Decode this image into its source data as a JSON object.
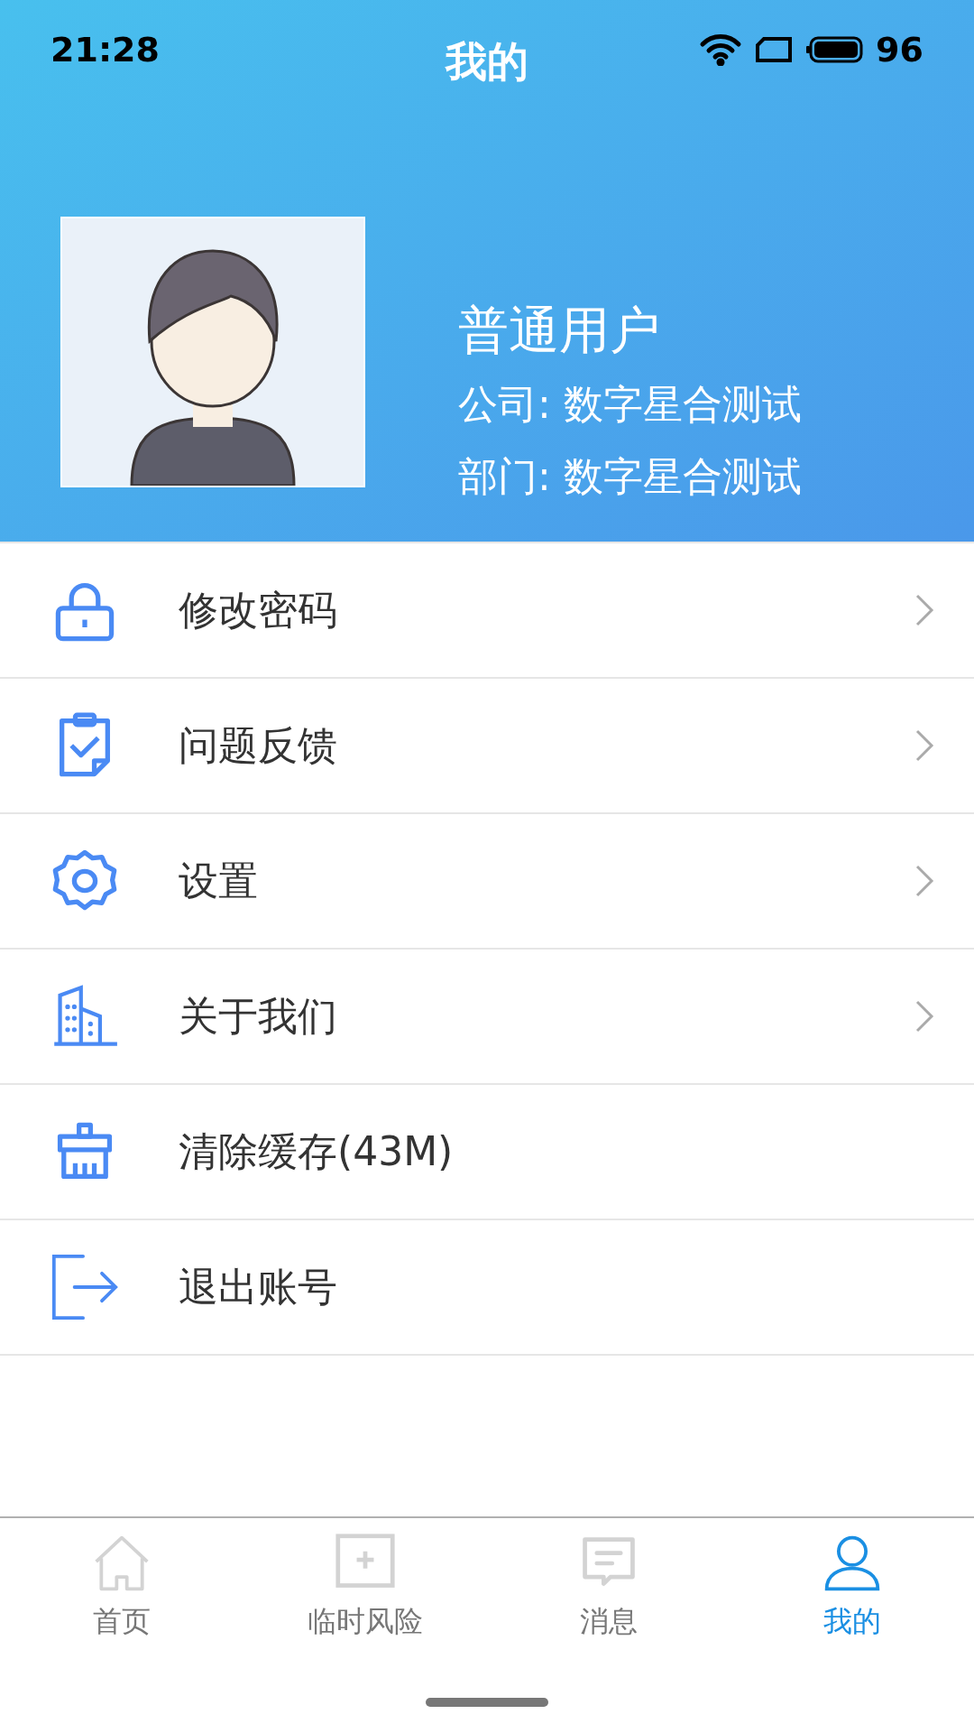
{
  "status_bar": {
    "time": "21:28",
    "battery": "96"
  },
  "title": "我的",
  "profile": {
    "name": "普通用户",
    "company": "公司: 数字星合测试",
    "department": "部门: 数字星合测试"
  },
  "menu": [
    {
      "label": "修改密码",
      "has_arrow": true
    },
    {
      "label": "问题反馈",
      "has_arrow": true
    },
    {
      "label": "设置",
      "has_arrow": true
    },
    {
      "label": "关于我们",
      "has_arrow": true
    },
    {
      "label": "清除缓存(43M)",
      "has_arrow": false
    },
    {
      "label": "退出账号",
      "has_arrow": false
    }
  ],
  "tabs": [
    {
      "label": "首页",
      "selected": false
    },
    {
      "label": "临时风险",
      "selected": false
    },
    {
      "label": "消息",
      "selected": false
    },
    {
      "label": "我的",
      "selected": true
    }
  ]
}
